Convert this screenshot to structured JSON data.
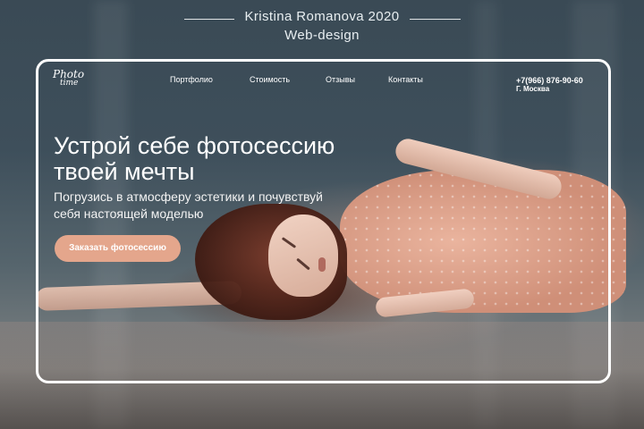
{
  "credit": {
    "title": "Kristina Romanova 2020",
    "subtitle": "Web-design"
  },
  "site": {
    "logo_line1": "Photo",
    "logo_line2": "time",
    "nav": [
      "Портфолио",
      "Стоимость",
      "Отзывы",
      "Контакты"
    ],
    "phone": "+7(966) 876-90-60",
    "city": "Г. Москва",
    "hero_title": "Устрой себе фотосессию твоей мечты",
    "hero_subtitle": "Погрузись в атмосферу эстетики и почувствуй себя настоящей моделью",
    "cta_label": "Заказать фотосессию"
  },
  "colors": {
    "accent": "#e4a68c",
    "frame": "#ffffff",
    "background": "#3e4f5b"
  }
}
